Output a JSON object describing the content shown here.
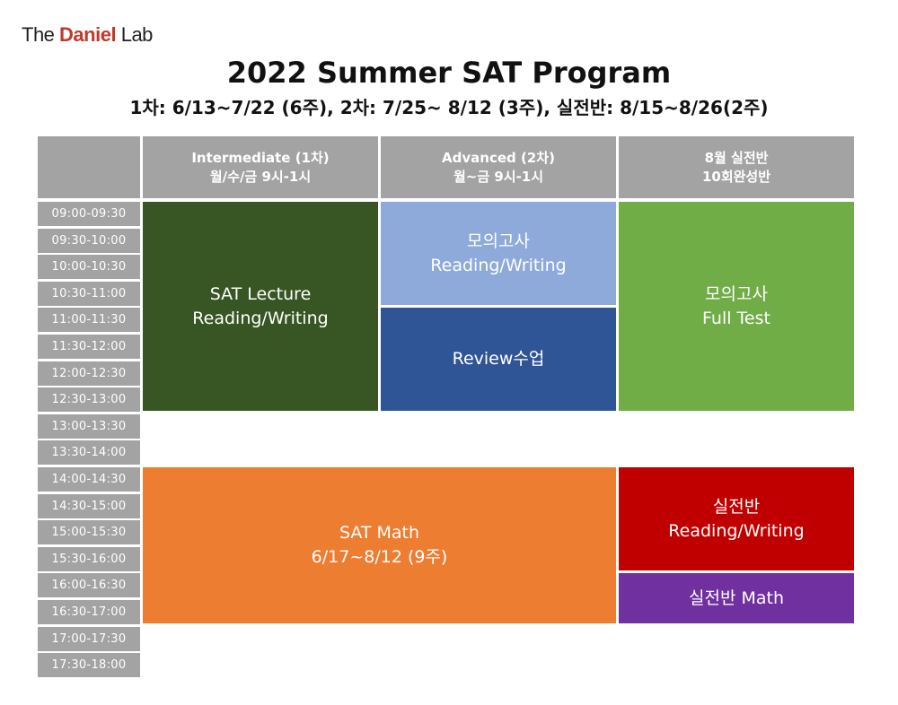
{
  "logo": {
    "prefix": "The",
    "brand": "Daniel",
    "suffix": "Lab"
  },
  "title": "2022 Summer SAT Program",
  "subtitle": "1차: 6/13~7/22 (6주), 2차: 7/25~ 8/12 (3주), 실전반: 8/15~8/26(2주)",
  "headers": [
    {
      "line1": "Intermediate (1차)",
      "line2": "월/수/금 9시-1시"
    },
    {
      "line1": "Advanced (2차)",
      "line2": "월~금 9시-1시"
    },
    {
      "line1": "8월 실전반",
      "line2": "10회완성반"
    }
  ],
  "times": [
    "09:00-09:30",
    "09:30-10:00",
    "10:00-10:30",
    "10:30-11:00",
    "11:00-11:30",
    "11:30-12:00",
    "12:00-12:30",
    "12:30-13:00",
    "13:00-13:30",
    "13:30-14:00",
    "14:00-14:30",
    "14:30-15:00",
    "15:00-15:30",
    "15:30-16:00",
    "16:00-16:30",
    "16:30-17:00",
    "17:00-17:30",
    "17:30-18:00"
  ],
  "blocks": {
    "lecture": {
      "line1": "SAT Lecture",
      "line2": "Reading/Writing",
      "color": "#375623"
    },
    "mock_advanced": {
      "line1": "모의고사",
      "line2": "Reading/Writing",
      "color": "#8eaadb"
    },
    "review": {
      "line1": "Review수업",
      "color": "#2f5597"
    },
    "mock_full": {
      "line1": "모의고사",
      "line2": "Full Test",
      "color": "#70ad47"
    },
    "math": {
      "line1": "SAT Math",
      "line2": "6/17~8/12 (9주)",
      "color": "#ed7d31"
    },
    "practice_rw": {
      "line1": "실전반",
      "line2": "Reading/Writing",
      "color": "#c00000"
    },
    "practice_math": {
      "line1": "실전반 Math",
      "color": "#7030a0"
    }
  }
}
